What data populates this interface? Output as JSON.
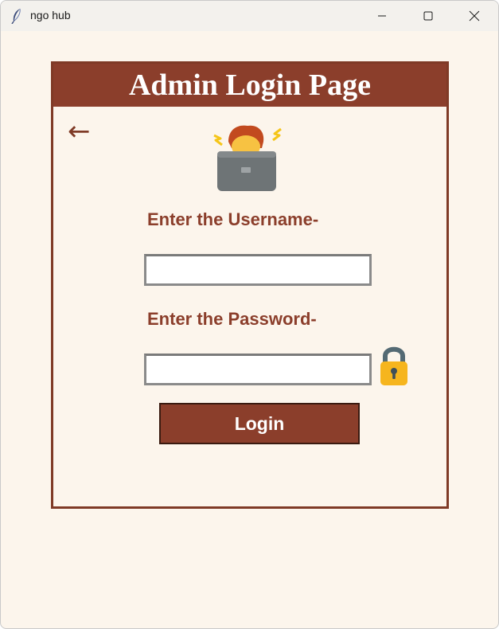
{
  "window": {
    "title": "ngo hub",
    "icons": {
      "app": "feather-icon",
      "minimize": "minimize-icon",
      "maximize": "maximize-icon",
      "close": "close-icon"
    }
  },
  "card": {
    "title": "Admin Login Page",
    "back_symbol": "←",
    "icons": {
      "admin": "technologist-icon",
      "lock": "lock-icon"
    },
    "username_label": "Enter the Username-",
    "username_value": "",
    "password_label": "Enter the Password-",
    "password_value": "",
    "login_label": "Login"
  },
  "colors": {
    "brand": "#8b3e2b",
    "background": "#fcf5ec",
    "titlebar": "#f3f1ed"
  }
}
